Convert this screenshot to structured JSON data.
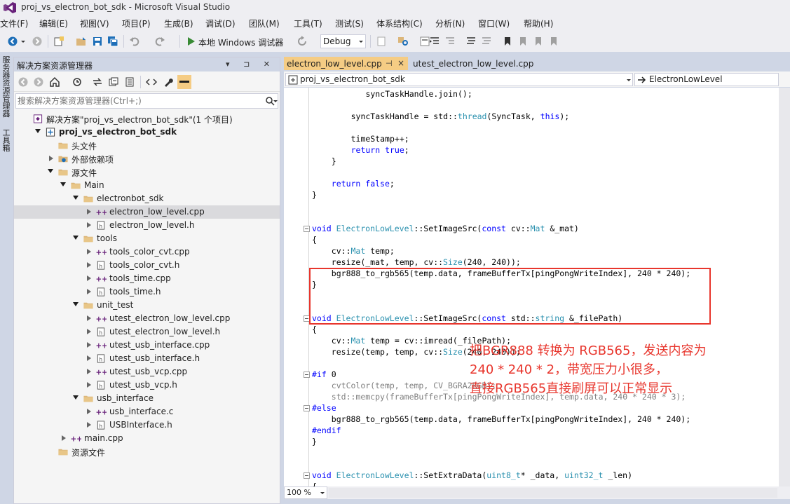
{
  "window": {
    "title": "proj_vs_electron_bot_sdk - Microsoft Visual Studio"
  },
  "menu": [
    "文件(F)",
    "编辑(E)",
    "视图(V)",
    "项目(P)",
    "生成(B)",
    "调试(D)",
    "团队(M)",
    "工具(T)",
    "测试(S)",
    "体系结构(C)",
    "分析(N)",
    "窗口(W)",
    "帮助(H)"
  ],
  "toolbar": {
    "run_label": "本地 Windows 调试器",
    "configuration": "Debug"
  },
  "left_strip": {
    "tab1": "服务器资源管理器",
    "tab2": "工具箱"
  },
  "solution_explorer": {
    "title": "解决方案资源管理器",
    "header_buttons": "▾ ⊐ ✕",
    "search_placeholder": "搜索解决方案资源管理器(Ctrl+;)",
    "tree": [
      {
        "label": "解决方案\"proj_vs_electron_bot_sdk\"(1 个项目)",
        "level": 0,
        "arrow": "none",
        "icon": "solution-icon",
        "bold": false,
        "selected": false
      },
      {
        "label": "proj_vs_electron_bot_sdk",
        "level": 1,
        "arrow": "open",
        "icon": "project-icon",
        "bold": true,
        "selected": false
      },
      {
        "label": "头文件",
        "level": 2,
        "arrow": "none",
        "icon": "folder-icon",
        "bold": false,
        "selected": false
      },
      {
        "label": "外部依赖项",
        "level": 2,
        "arrow": "closed",
        "icon": "dependencies-icon",
        "bold": false,
        "selected": false
      },
      {
        "label": "源文件",
        "level": 2,
        "arrow": "open",
        "icon": "folder-icon",
        "bold": false,
        "selected": false
      },
      {
        "label": "Main",
        "level": 3,
        "arrow": "open",
        "icon": "folder-icon",
        "bold": false,
        "selected": false
      },
      {
        "label": "electronbot_sdk",
        "level": 4,
        "arrow": "open",
        "icon": "folder-icon",
        "bold": false,
        "selected": false
      },
      {
        "label": "electron_low_level.cpp",
        "level": 5,
        "arrow": "closed",
        "icon": "cpp-file-icon",
        "bold": false,
        "selected": true
      },
      {
        "label": "electron_low_level.h",
        "level": 5,
        "arrow": "closed",
        "icon": "header-file-icon",
        "bold": false,
        "selected": false
      },
      {
        "label": "tools",
        "level": 4,
        "arrow": "open",
        "icon": "folder-icon",
        "bold": false,
        "selected": false
      },
      {
        "label": "tools_color_cvt.cpp",
        "level": 5,
        "arrow": "closed",
        "icon": "cpp-file-icon",
        "bold": false,
        "selected": false
      },
      {
        "label": "tools_color_cvt.h",
        "level": 5,
        "arrow": "closed",
        "icon": "header-file-icon",
        "bold": false,
        "selected": false
      },
      {
        "label": "tools_time.cpp",
        "level": 5,
        "arrow": "closed",
        "icon": "cpp-file-icon",
        "bold": false,
        "selected": false
      },
      {
        "label": "tools_time.h",
        "level": 5,
        "arrow": "closed",
        "icon": "header-file-icon",
        "bold": false,
        "selected": false
      },
      {
        "label": "unit_test",
        "level": 4,
        "arrow": "open",
        "icon": "folder-icon",
        "bold": false,
        "selected": false
      },
      {
        "label": "utest_electron_low_level.cpp",
        "level": 5,
        "arrow": "closed",
        "icon": "cpp-file-icon",
        "bold": false,
        "selected": false
      },
      {
        "label": "utest_electron_low_level.h",
        "level": 5,
        "arrow": "closed",
        "icon": "header-file-icon",
        "bold": false,
        "selected": false
      },
      {
        "label": "utest_usb_interface.cpp",
        "level": 5,
        "arrow": "closed",
        "icon": "cpp-file-icon",
        "bold": false,
        "selected": false
      },
      {
        "label": "utest_usb_interface.h",
        "level": 5,
        "arrow": "closed",
        "icon": "header-file-icon",
        "bold": false,
        "selected": false
      },
      {
        "label": "utest_usb_vcp.cpp",
        "level": 5,
        "arrow": "closed",
        "icon": "cpp-file-icon",
        "bold": false,
        "selected": false
      },
      {
        "label": "utest_usb_vcp.h",
        "level": 5,
        "arrow": "closed",
        "icon": "header-file-icon",
        "bold": false,
        "selected": false
      },
      {
        "label": "usb_interface",
        "level": 4,
        "arrow": "open",
        "icon": "folder-icon",
        "bold": false,
        "selected": false
      },
      {
        "label": "usb_interface.c",
        "level": 5,
        "arrow": "closed",
        "icon": "cpp-file-icon",
        "bold": false,
        "selected": false
      },
      {
        "label": "USBInterface.h",
        "level": 5,
        "arrow": "closed",
        "icon": "header-file-icon",
        "bold": false,
        "selected": false
      },
      {
        "label": "main.cpp",
        "level": 3,
        "arrow": "closed",
        "icon": "cpp-file-icon",
        "bold": false,
        "selected": false
      },
      {
        "label": "资源文件",
        "level": 2,
        "arrow": "none",
        "icon": "folder-icon",
        "bold": false,
        "selected": false
      }
    ]
  },
  "editor": {
    "tabs": [
      {
        "label": "electron_low_level.cpp",
        "pin": "⊣",
        "close": "×"
      },
      {
        "label": "utest_electron_low_level.cpp"
      }
    ],
    "nav_project": "proj_vs_electron_bot_sdk",
    "nav_scope": "ElectronLowLevel",
    "zoom": "100 %",
    "code_lines": [
      {
        "row": 0,
        "indent": 11,
        "tokens": [
          [
            "",
            "syncTaskHandle.join();"
          ]
        ]
      },
      {
        "row": 2,
        "indent": 8,
        "tokens": [
          [
            "",
            "syncTaskHandle = std::"
          ],
          [
            "ty",
            "thread"
          ],
          [
            "",
            "(SyncTask, "
          ],
          [
            "kw",
            "this"
          ],
          [
            "",
            ");"
          ]
        ]
      },
      {
        "row": 4,
        "indent": 8,
        "tokens": [
          [
            "",
            "timeStamp++;"
          ]
        ]
      },
      {
        "row": 5,
        "indent": 8,
        "tokens": [
          [
            "kw",
            "return"
          ],
          [
            "",
            " "
          ],
          [
            "kw",
            "true"
          ],
          [
            "",
            ";"
          ]
        ]
      },
      {
        "row": 6,
        "indent": 4,
        "tokens": [
          [
            "",
            "}"
          ]
        ]
      },
      {
        "row": 8,
        "indent": 4,
        "tokens": [
          [
            "kw",
            "return"
          ],
          [
            "",
            " "
          ],
          [
            "kw",
            "false"
          ],
          [
            "",
            ";"
          ]
        ]
      },
      {
        "row": 9,
        "indent": 0,
        "tokens": [
          [
            "",
            "}"
          ]
        ]
      },
      {
        "row": 12,
        "indent": 0,
        "fold": true,
        "tokens": [
          [
            "kw",
            "void"
          ],
          [
            "",
            " "
          ],
          [
            "ty",
            "ElectronLowLevel"
          ],
          [
            "",
            "::SetImageSrc("
          ],
          [
            "kw",
            "const"
          ],
          [
            "",
            " cv::"
          ],
          [
            "ty",
            "Mat"
          ],
          [
            "",
            " &_mat)"
          ]
        ]
      },
      {
        "row": 13,
        "indent": 0,
        "tokens": [
          [
            "",
            "{"
          ]
        ]
      },
      {
        "row": 14,
        "indent": 4,
        "tokens": [
          [
            "",
            "cv::"
          ],
          [
            "ty",
            "Mat"
          ],
          [
            "",
            " temp;"
          ]
        ]
      },
      {
        "row": 15,
        "indent": 4,
        "tokens": [
          [
            "",
            "resize(_mat, temp, cv::"
          ],
          [
            "ty",
            "Size"
          ],
          [
            "",
            "(240, 240));"
          ]
        ]
      },
      {
        "row": 16,
        "indent": 4,
        "tokens": [
          [
            "",
            "bgr888_to_rgb565(temp.data, frameBufferTx[pingPongWriteIndex], 240 * 240);"
          ]
        ]
      },
      {
        "row": 17,
        "indent": 0,
        "tokens": [
          [
            "",
            "}"
          ]
        ]
      },
      {
        "row": 20,
        "indent": 0,
        "fold": true,
        "tokens": [
          [
            "kw",
            "void"
          ],
          [
            "",
            " "
          ],
          [
            "ty",
            "ElectronLowLevel"
          ],
          [
            "",
            "::SetImageSrc("
          ],
          [
            "kw",
            "const"
          ],
          [
            "",
            " std::"
          ],
          [
            "ty",
            "string"
          ],
          [
            "",
            " &_filePath)"
          ]
        ]
      },
      {
        "row": 21,
        "indent": 0,
        "tokens": [
          [
            "",
            "{"
          ]
        ]
      },
      {
        "row": 22,
        "indent": 4,
        "tokens": [
          [
            "",
            "cv::"
          ],
          [
            "ty",
            "Mat"
          ],
          [
            "",
            " temp = cv::imread(_filePath);"
          ]
        ]
      },
      {
        "row": 23,
        "indent": 4,
        "tokens": [
          [
            "",
            "resize(temp, temp, cv::"
          ],
          [
            "ty",
            "Size"
          ],
          [
            "",
            "(240, 240));"
          ]
        ]
      },
      {
        "row": 25,
        "indent": 0,
        "fold": true,
        "tokens": [
          [
            "pp",
            "#if"
          ],
          [
            "",
            " 0"
          ]
        ]
      },
      {
        "row": 26,
        "indent": 4,
        "tokens": [
          [
            "dis",
            "cvtColor(temp, temp, CV_BGRA2RGB);"
          ]
        ]
      },
      {
        "row": 27,
        "indent": 4,
        "tokens": [
          [
            "dis",
            "std::memcpy(frameBufferTx[pingPongWriteIndex], temp.data, 240 * 240 * 3);"
          ]
        ]
      },
      {
        "row": 28,
        "indent": 0,
        "fold": true,
        "tokens": [
          [
            "pp",
            "#else"
          ]
        ]
      },
      {
        "row": 29,
        "indent": 4,
        "tokens": [
          [
            "",
            "bgr888_to_rgb565(temp.data, frameBufferTx[pingPongWriteIndex], 240 * 240);"
          ]
        ]
      },
      {
        "row": 30,
        "indent": 0,
        "tokens": [
          [
            "pp",
            "#endif"
          ]
        ]
      },
      {
        "row": 31,
        "indent": 0,
        "tokens": [
          [
            "",
            "}"
          ]
        ]
      },
      {
        "row": 34,
        "indent": 0,
        "fold": true,
        "tokens": [
          [
            "kw",
            "void"
          ],
          [
            "",
            " "
          ],
          [
            "ty",
            "ElectronLowLevel"
          ],
          [
            "",
            "::SetExtraData("
          ],
          [
            "ty",
            "uint8_t"
          ],
          [
            "",
            "* _data, "
          ],
          [
            "ty",
            "uint32_t"
          ],
          [
            "",
            " _len)"
          ]
        ]
      },
      {
        "row": 35,
        "indent": 0,
        "tokens": [
          [
            "",
            "{"
          ]
        ]
      }
    ]
  },
  "annotation": {
    "lines": [
      "把BGR888 转换为 RGB565，发送内容为",
      "240 * 240 * 2，带宽压力小很多，",
      "直接RGB565直接刷屏可以正常显示"
    ]
  },
  "colors": {
    "annotation_red": "#e8362d",
    "active_tab": "#f5cc84",
    "keyword": "#0000ff",
    "type": "#2b91af"
  }
}
